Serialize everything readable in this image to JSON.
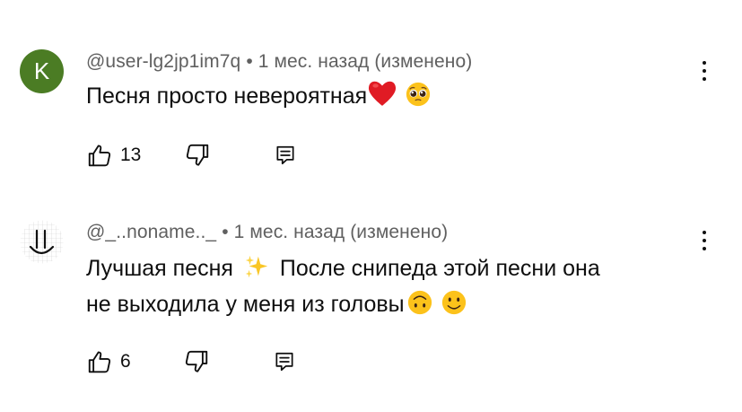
{
  "comments": [
    {
      "avatar_letter": "K",
      "avatar_color": "#4b7c24",
      "author": "@user-lg2jp1im7q",
      "time": "1 мес. назад (изменено)",
      "text_lines": [
        "Песня просто невероятная"
      ],
      "emojis": [
        "red-heart",
        "pleading-face"
      ],
      "likes": "13"
    },
    {
      "avatar_letter": "",
      "author": "@_..noname.._",
      "time": "1 мес. назад (изменено)",
      "text_lines": [
        "Лучшая песня",
        "После снипеда этой песни она",
        "не выходила у меня из головы"
      ],
      "emojis": [
        "sparkles",
        "upside-down-face",
        "slightly-smiling-face"
      ],
      "likes": "6"
    }
  ],
  "separator": "•",
  "colors": {
    "text_primary": "#0f0f0f",
    "text_secondary": "#606060",
    "avatar_green": "#4b7c24"
  }
}
